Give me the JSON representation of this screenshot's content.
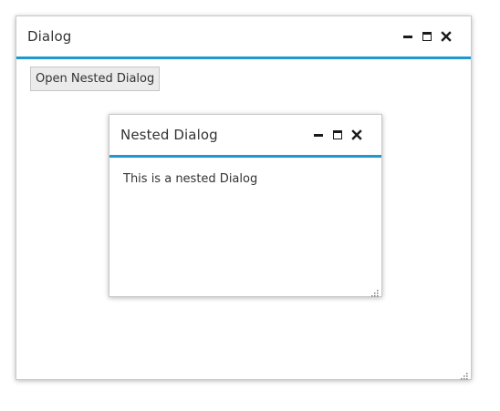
{
  "outer_dialog": {
    "title": "Dialog",
    "open_button_label": "Open Nested Dialog"
  },
  "nested_dialog": {
    "title": "Nested Dialog",
    "body_text": "This is a nested Dialog"
  },
  "icons": {
    "minimize": "minimize-icon",
    "maximize": "maximize-icon",
    "close": "close-icon",
    "resize": "resize-grip-icon"
  },
  "colors": {
    "header_accent": "#1e98cf",
    "button_bg": "#ebebeb",
    "text": "#333333"
  }
}
